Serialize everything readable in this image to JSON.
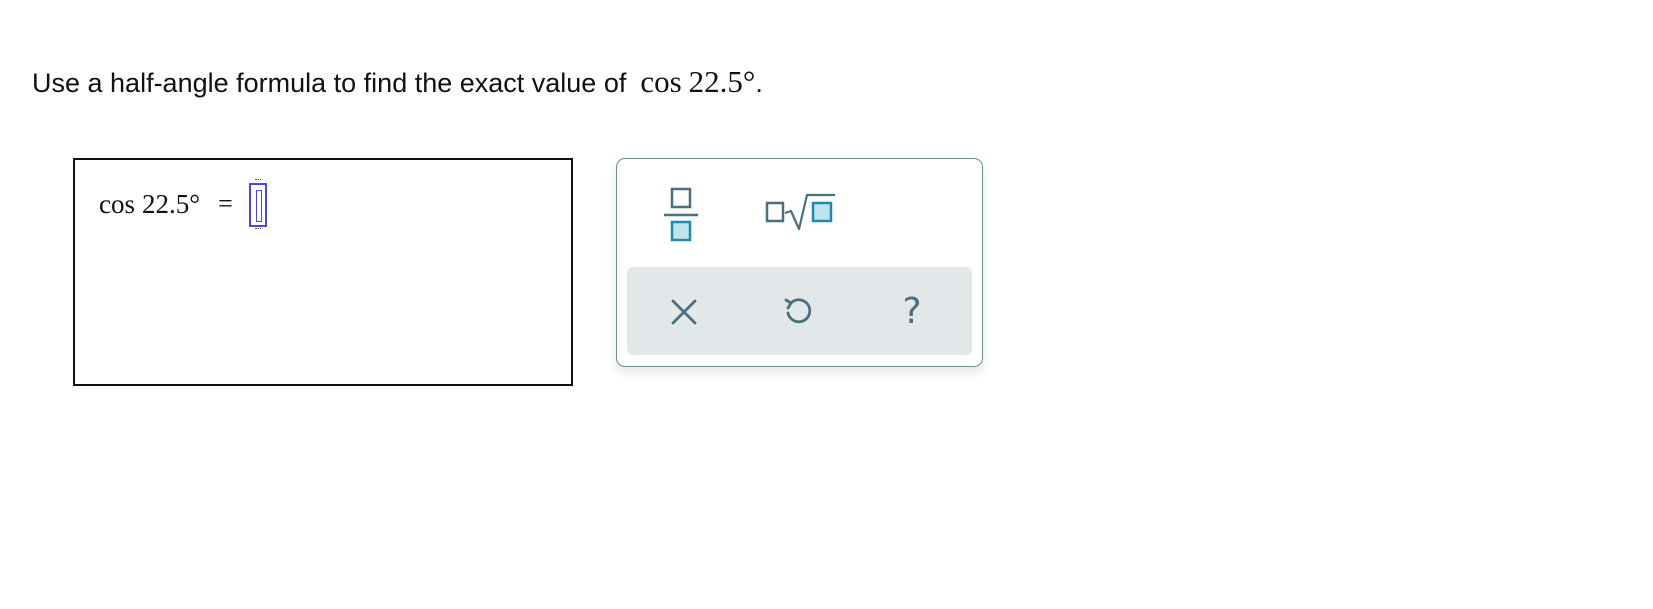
{
  "question": {
    "text": "Use a half-angle formula to find the exact value of",
    "math_fn": "cos",
    "math_value": "22.5°",
    "period": "."
  },
  "answer": {
    "math_fn": "cos",
    "math_value": "22.5°",
    "equals": "="
  },
  "palette": {
    "tools": [
      "fraction-template",
      "nth-root-template"
    ],
    "actions": {
      "clear_icon": "x-icon",
      "undo_icon": "undo-icon",
      "help_label": "?"
    }
  },
  "colors": {
    "accent": "#4b6f7c",
    "fill_light": "#bfe3ea",
    "action_bar_bg": "#e2e8ea",
    "cursor": "#4a4ae0"
  }
}
